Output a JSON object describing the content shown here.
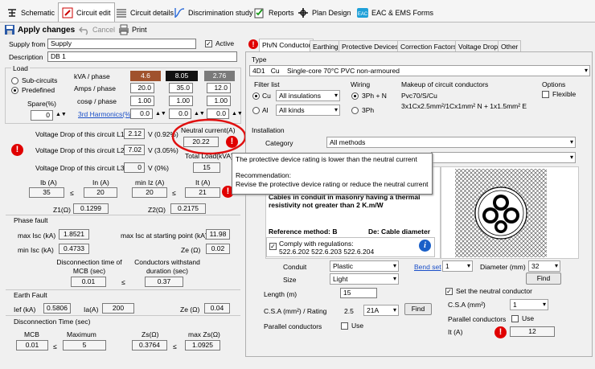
{
  "tabs": [
    {
      "label": "Schematic",
      "icon": "schematic-icon"
    },
    {
      "label": "Circuit edit",
      "icon": "circuit-edit-icon"
    },
    {
      "label": "Circuit details",
      "icon": "circuit-details-icon"
    },
    {
      "label": "Discrimination study",
      "icon": "discrimination-icon"
    },
    {
      "label": "Reports",
      "icon": "reports-icon"
    },
    {
      "label": "Plan Design",
      "icon": "plan-design-icon"
    },
    {
      "label": "EAC & EMS Forms",
      "icon": "eac-forms-icon"
    }
  ],
  "toolbar": {
    "apply": "Apply changes",
    "cancel": "Cancel",
    "print": "Print"
  },
  "supply": {
    "supply_from_label": "Supply from",
    "supply_from": "Supply",
    "description_label": "Description",
    "description": "DB 1",
    "active_label": "Active"
  },
  "load": {
    "title": "Load",
    "sub_circuits": "Sub-circuits",
    "predefined": "Predefined",
    "spare_label": "Spare(%)",
    "spare": "0",
    "kva_label": "kVA / phase",
    "kva": [
      "4.6",
      "8.05",
      "2.76"
    ],
    "amps_label": "Amps / phase",
    "amps": [
      "20.0",
      "35.0",
      "12.0"
    ],
    "cosphi_label": "cosφ / phase",
    "cosphi": [
      "1.00",
      "1.00",
      "1.00"
    ],
    "harm_label": "3rd Harmonics(%)",
    "harm": [
      "0.0",
      "0.0",
      "0.0"
    ],
    "phase_colors": [
      "#a0522d",
      "#111111",
      "#7a7a7a"
    ]
  },
  "vdrop": {
    "l1_label": "Voltage Drop of this circuit L1",
    "l1": "2.12",
    "l1_unit": "V (0.92%)",
    "l2_label": "Voltage Drop of this circuit L2",
    "l2": "7.02",
    "l2_unit": "V (3.05%)",
    "l3_label": "Voltage Drop of this circuit L3",
    "l3": "0",
    "l3_unit": "V (0%)",
    "neutral_label": "Neutral current(A)",
    "neutral": "20.22",
    "total_label": "Total Load(kVA)",
    "total": "15"
  },
  "currents": {
    "ib_label": "Ib (A)",
    "ib": "35",
    "le1": "≤",
    "in_label": "In (A)",
    "in": "20",
    "iz_label": "min Iz (A)",
    "iz": "20",
    "le2": "≤",
    "it_label": "It (A)",
    "it": "21",
    "z1_label": "Z1(Ω)",
    "z1": "0.1299",
    "z2_label": "Z2(Ω)",
    "z2": "0.2175"
  },
  "phase_fault": {
    "title": "Phase fault",
    "max_isc_label": "max Isc (kA)",
    "max_isc": "1.8521",
    "max_isc_start_label": "max Isc at starting point (kA)",
    "max_isc_start": "11.98",
    "min_isc_label": "min Isc (kA)",
    "min_isc": "0.4733",
    "ze_label": "Ze (Ω)",
    "ze": "0.02",
    "disc_label": "Disconnection time of MCB (sec)",
    "disc": "0.01",
    "le": "≤",
    "withstand_label": "Conductors withstand duration (sec)",
    "withstand": "0.37"
  },
  "earth_fault": {
    "title": "Earth Fault",
    "ief_label": "Ief (kA)",
    "ief": "0.5806",
    "ia_label": "Ia(A)",
    "ia": "200",
    "ze_label": "Ze (Ω)",
    "ze": "0.04",
    "disc_title": "Disconnection Time (sec)",
    "mcb_label": "MCB",
    "mcb": "0.01",
    "le1": "≤",
    "max_label": "Maximum",
    "max": "5",
    "zs_label": "Zs(Ω)",
    "zs": "0.3764",
    "le2": "≤",
    "maxzs_label": "max Zs(Ω)",
    "maxzs": "1.0925"
  },
  "right_tabs": [
    "Ph/N Conductor",
    "Earthing",
    "Protective Devices",
    "Correction Factors",
    "Voltage Drop",
    "Other"
  ],
  "conductor": {
    "type_title": "Type",
    "type_code": "4D1",
    "type_material": "Cu",
    "type_desc": "Single-core 70°C PVC non-armoured",
    "filter_title": "Filter list",
    "cu_label": "Cu",
    "al_label": "Al",
    "insulation": "All insulations",
    "kinds": "All kinds",
    "wiring_title": "Wiring",
    "wiring_3phn": "3Ph + N",
    "wiring_3ph": "3Ph",
    "makeup_title": "Makeup of circuit conductors",
    "makeup1": "Pvc70/S/Cu",
    "makeup2": "3x1Cx2.5mm²/1Cx1mm² N + 1x1.5mm² E",
    "options_title": "Options",
    "flexible": "Flexible"
  },
  "installation": {
    "title": "Installation",
    "category_label": "Category",
    "category": "All methods",
    "method_desc": "Cables in conduit in masonry having a thermal resistivity not greater than 2 K.m/W",
    "ref_label": "Reference method: B",
    "de_label": "De: Cable diameter",
    "comply_label": "Comply with regulations:",
    "comply_refs": "522.6.202 522.6.203 522.6.204",
    "conduit_label": "Conduit",
    "conduit": "Plastic",
    "bend_label": "Bend set",
    "bend": "1",
    "diameter_label": "Diameter (mm)",
    "diameter": "32",
    "size_label": "Size",
    "size": "Light",
    "find": "Find"
  },
  "bottom": {
    "length_label": "Length (m)",
    "length": "15",
    "csa_label": "C.S.A (mm²) / Rating",
    "csa": "2.5",
    "rating": "21A",
    "find": "Find",
    "parallel_label": "Parallel conductors",
    "use": "Use",
    "neutral_set": "Set the neutral conductor",
    "n_csa_label": "C.S.A (mm²)",
    "n_csa": "1",
    "n_parallel_label": "Parallel conductors",
    "n_use": "Use",
    "it_label": "It (A)",
    "it": "12"
  },
  "tooltip": {
    "line1": "The protective device rating is lower than the neutral current",
    "line2": "Recommendation:",
    "line3": "Revise the protective device rating or reduce the neutral current"
  },
  "colors": {
    "error": "#e00000",
    "highlight_ring": "#e01010",
    "info": "#1a5fc8"
  }
}
